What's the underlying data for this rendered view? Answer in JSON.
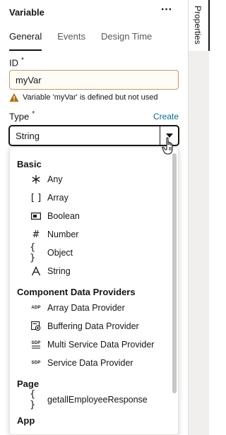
{
  "panel": {
    "title": "Variable",
    "tabs": [
      {
        "label": "General",
        "active": true
      },
      {
        "label": "Events",
        "active": false
      },
      {
        "label": "Design Time",
        "active": false
      }
    ]
  },
  "rail": {
    "label": "Properties"
  },
  "id_field": {
    "label": "ID",
    "required_mark": "*",
    "value": "myVar",
    "warning": "Variable 'myVar' is defined but not used"
  },
  "type_field": {
    "label": "Type",
    "required_mark": "*",
    "create_link": "Create",
    "value": "String"
  },
  "dropdown": {
    "groups": [
      {
        "label": "Basic",
        "options": [
          {
            "label": "Any",
            "icon": "asterisk-icon"
          },
          {
            "label": "Array",
            "icon": "brackets-icon"
          },
          {
            "label": "Boolean",
            "icon": "toggle-icon"
          },
          {
            "label": "Number",
            "icon": "hash-icon"
          },
          {
            "label": "Object",
            "icon": "braces-icon"
          },
          {
            "label": "String",
            "icon": "letter-a-icon"
          }
        ]
      },
      {
        "label": "Component Data Providers",
        "options": [
          {
            "label": "Array Data Provider",
            "icon": "adp-icon",
            "badge": "ADP"
          },
          {
            "label": "Buffering Data Provider",
            "icon": "buffering-icon"
          },
          {
            "label": "Multi Service Data Provider",
            "icon": "sdp-stack-icon",
            "badge": "SDP"
          },
          {
            "label": "Service Data Provider",
            "icon": "sdp-icon",
            "badge": "SDP"
          }
        ]
      },
      {
        "label": "Page",
        "options": [
          {
            "label": "getallEmployeeResponse",
            "icon": "braces-icon"
          }
        ]
      },
      {
        "label": "App",
        "options": []
      }
    ]
  },
  "colors": {
    "accent_link": "#006b8f",
    "warning_border": "#c3996c",
    "warning_icon": "#b36b00"
  }
}
